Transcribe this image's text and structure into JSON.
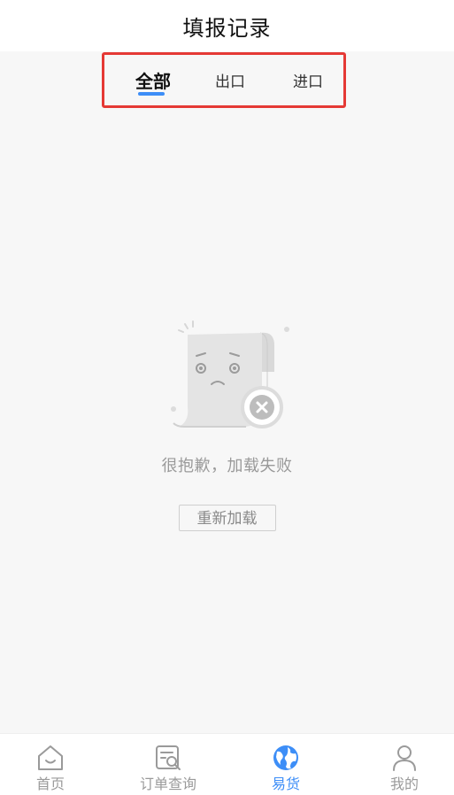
{
  "header": {
    "title": "填报记录"
  },
  "tabs": [
    {
      "label": "全部",
      "active": true
    },
    {
      "label": "出口",
      "active": false
    },
    {
      "label": "进口",
      "active": false
    }
  ],
  "empty_state": {
    "message": "很抱歉，加载失败",
    "reload_label": "重新加载",
    "icon": "document-error-illustration"
  },
  "bottom_nav": [
    {
      "label": "首页",
      "icon": "home-icon",
      "active": false
    },
    {
      "label": "订单查询",
      "icon": "order-search-icon",
      "active": false
    },
    {
      "label": "易货",
      "icon": "globe-icon",
      "active": true
    },
    {
      "label": "我的",
      "icon": "user-icon",
      "active": false
    }
  ],
  "colors": {
    "accent": "#3d8ef7",
    "highlight_border": "#e53935",
    "inactive_text": "#9a9a9a",
    "background": "#f7f7f7"
  }
}
